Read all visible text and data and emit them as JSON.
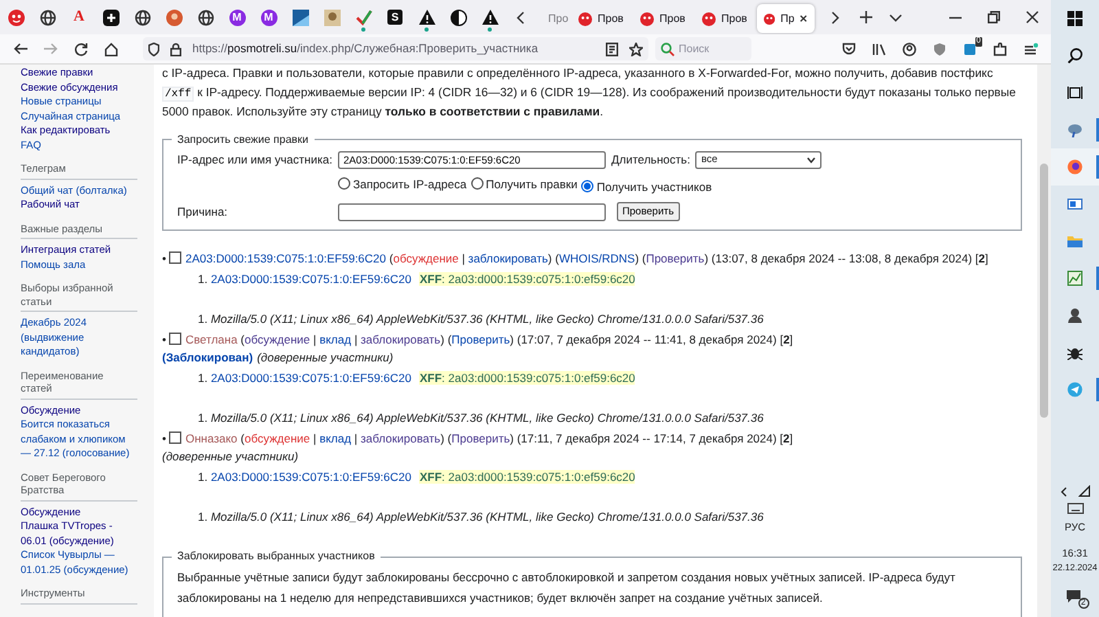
{
  "browser": {
    "pinned_tabs": [
      {
        "kind": "face"
      },
      {
        "kind": "globe"
      },
      {
        "kind": "letter",
        "text": "A",
        "color": "#e02020"
      },
      {
        "kind": "plus"
      },
      {
        "kind": "globe"
      },
      {
        "kind": "avatar"
      },
      {
        "kind": "globe"
      },
      {
        "kind": "badge-letter",
        "text": "M",
        "color": "#8a2be2"
      },
      {
        "kind": "badge-letter",
        "text": "M",
        "color": "#8a2be2"
      },
      {
        "kind": "image"
      },
      {
        "kind": "photo"
      },
      {
        "kind": "check",
        "attention": true
      },
      {
        "kind": "square-letter",
        "text": "S",
        "color": "#111111"
      },
      {
        "kind": "warning",
        "attention": true
      },
      {
        "kind": "halfcircle"
      },
      {
        "kind": "warning",
        "attention": true
      }
    ],
    "tabs": [
      {
        "label": "Про",
        "selected": false
      },
      {
        "label": "Пров",
        "selected": false
      },
      {
        "label": "Пров",
        "selected": false
      },
      {
        "label": "Пров",
        "selected": false
      },
      {
        "label": "Пр",
        "selected": true
      }
    ],
    "url_parts": [
      "https://",
      "posmotreli.su",
      "/index.php/Служебная:Проверить_участника"
    ],
    "search_placeholder": "Поиск",
    "extension_badge": "0"
  },
  "sidebar": [
    {
      "items": [
        {
          "text": "Свежие правки",
          "visited": true
        },
        {
          "text": "Свежие обсуждения",
          "visited": true
        },
        {
          "text": "Новые страницы",
          "visited": false
        },
        {
          "text": "Случайная страница",
          "visited": false
        },
        {
          "text": "Как редактировать",
          "visited": true
        },
        {
          "text": "FAQ",
          "visited": false
        }
      ]
    },
    {
      "heading": "Телеграм",
      "items": [
        {
          "text": "Общий чат (болталка)",
          "visited": false
        },
        {
          "text": "Рабочий чат",
          "visited": true
        }
      ]
    },
    {
      "heading": "Важные разделы",
      "items": [
        {
          "text": "Интеграция статей",
          "visited": true
        },
        {
          "text": "Помощь зала",
          "visited": false
        }
      ]
    },
    {
      "heading": "Выборы избранной статьи",
      "items": [
        {
          "text": "Декабрь 2024 (выдвижение кандидатов)",
          "visited": false
        }
      ]
    },
    {
      "heading": "Переименование статей",
      "items": [
        {
          "text": "Обсуждение",
          "visited": true
        },
        {
          "text": "Боится показаться слабаком и хлюпиком — 27.12 (голосование)",
          "visited": false
        }
      ]
    },
    {
      "heading": "Совет Берегового Братства",
      "items": [
        {
          "text": "Обсуждение",
          "visited": true
        },
        {
          "text": "Плашка TVTropes - 06.01 (обсуждение)",
          "visited": true
        },
        {
          "text": "Список Чувырлы — 01.01.25 (обсуждение)",
          "visited": false
        }
      ]
    },
    {
      "heading": "Инструменты"
    }
  ],
  "intro": {
    "before": "с IP-адреса. Правки и пользователи, которые правили с определённого IP-адреса, указанного в X-Forwarded-For, можно получить, добавив постфикс ",
    "code": "/xff",
    "after": " к IP-адресу. Поддерживаемые версии IP: 4 (CIDR 16—32) и 6 (CIDR 19—128). Из соображений производительности будут показаны только первые 5000 правок. Используйте эту страницу **только в соответствии с правилами**."
  },
  "query_form": {
    "legend": "Запросить свежие правки",
    "target_label": "IP-адрес или имя участника:",
    "target_value": "2A03:D000:1539:C075:1:0:EF59:6C20",
    "duration_label": "Длительность:",
    "duration_value": "все",
    "radios": [
      {
        "label": "Запросить IP-адреса",
        "selected": false
      },
      {
        "label": "Получить правки",
        "selected": false
      },
      {
        "label": "Получить участников",
        "selected": true
      }
    ],
    "reason_label": "Причина:",
    "submit": "Проверить"
  },
  "results": [
    {
      "marker": "•",
      "checked": false,
      "line": [
        {
          "kind": "link",
          "text": "2A03:D000:1539:C075:1:0:EF59:6C20",
          "new": false,
          "visited": false
        },
        {
          "kind": "text",
          "text": " ("
        },
        {
          "kind": "link",
          "text": "обсуждение",
          "new": true,
          "visited": false
        },
        {
          "kind": "text",
          "text": " | "
        },
        {
          "kind": "link",
          "text": "заблокировать",
          "new": false,
          "visited": false
        },
        {
          "kind": "text",
          "text": ") ("
        },
        {
          "kind": "link",
          "text": "WHOIS/RDNS",
          "new": false,
          "visited": false
        },
        {
          "kind": "text",
          "text": ") ("
        },
        {
          "kind": "link",
          "text": "Проверить",
          "new": false,
          "visited": true
        },
        {
          "kind": "text",
          "text": ") (13:07, 8 декабря 2024 -- 13:08, 8 декабря 2024) ["
        },
        {
          "kind": "count",
          "text": "2"
        },
        {
          "kind": "text",
          "text": "]"
        }
      ],
      "ips": [
        {
          "number": "1.",
          "ip": "2A03:D000:1539:C075:1:0:EF59:6C20",
          "xff": "**XFF**: 2a03:d000:1539:c075:1:0:ef59:6c20"
        }
      ],
      "agents": [
        {
          "number": "1.",
          "text": "Mozilla/5.0 (X11; Linux x86_64) AppleWebKit/537.36 (KHTML, like Gecko) Chrome/131.0.0.0 Safari/537.36"
        }
      ]
    },
    {
      "marker": "•",
      "checked": false,
      "line": [
        {
          "kind": "link",
          "text": "Светлана",
          "new": true,
          "visited": true
        },
        {
          "kind": "text",
          "text": " ("
        },
        {
          "kind": "link",
          "text": "обсуждение",
          "new": false,
          "visited": true
        },
        {
          "kind": "text",
          "text": " | "
        },
        {
          "kind": "link",
          "text": "вклад",
          "new": false,
          "visited": false
        },
        {
          "kind": "text",
          "text": " | "
        },
        {
          "kind": "link",
          "text": "заблокировать",
          "new": false,
          "visited": true
        },
        {
          "kind": "text",
          "text": ") ("
        },
        {
          "kind": "link",
          "text": "Проверить",
          "new": false,
          "visited": false
        },
        {
          "kind": "text",
          "text": ") (17:07, 7 декабря 2024 -- 11:41, 8 декабря 2024) ["
        },
        {
          "kind": "count",
          "text": "2"
        },
        {
          "kind": "text",
          "text": "]"
        }
      ],
      "second_line": [
        {
          "kind": "boldlink",
          "text": "(Заблокирован)",
          "new": false,
          "visited": false
        },
        {
          "kind": "italic",
          "text": "(доверенные участники)"
        }
      ],
      "ips": [
        {
          "number": "1.",
          "ip": "2A03:D000:1539:C075:1:0:EF59:6C20",
          "xff": "**XFF**: 2a03:d000:1539:c075:1:0:ef59:6c20"
        }
      ],
      "agents": [
        {
          "number": "1.",
          "text": "Mozilla/5.0 (X11; Linux x86_64) AppleWebKit/537.36 (KHTML, like Gecko) Chrome/131.0.0.0 Safari/537.36"
        }
      ]
    },
    {
      "marker": "•",
      "checked": false,
      "line": [
        {
          "kind": "link",
          "text": "Онназако",
          "new": true,
          "visited": true
        },
        {
          "kind": "text",
          "text": " ("
        },
        {
          "kind": "link",
          "text": "обсуждение",
          "new": true,
          "visited": false
        },
        {
          "kind": "text",
          "text": " | "
        },
        {
          "kind": "link",
          "text": "вклад",
          "new": false,
          "visited": false
        },
        {
          "kind": "text",
          "text": " | "
        },
        {
          "kind": "link",
          "text": "заблокировать",
          "new": false,
          "visited": true
        },
        {
          "kind": "text",
          "text": ") ("
        },
        {
          "kind": "link",
          "text": "Проверить",
          "new": false,
          "visited": true
        },
        {
          "kind": "text",
          "text": ") (17:11, 7 декабря 2024 -- 17:14, 7 декабря 2024) ["
        },
        {
          "kind": "count",
          "text": "2"
        },
        {
          "kind": "text",
          "text": "]"
        }
      ],
      "second_line": [
        {
          "kind": "italic",
          "text": "(доверенные участники)"
        }
      ],
      "ips": [
        {
          "number": "1.",
          "ip": "2A03:D000:1539:C075:1:0:EF59:6C20",
          "xff": "**XFF**: 2a03:d000:1539:c075:1:0:ef59:6c20"
        }
      ],
      "agents": [
        {
          "number": "1.",
          "text": "Mozilla/5.0 (X11; Linux x86_64) AppleWebKit/537.36 (KHTML, like Gecko) Chrome/131.0.0.0 Safari/537.36"
        }
      ]
    }
  ],
  "block_form": {
    "legend": "Заблокировать выбранных участников",
    "text": "Выбранные учётные записи будут заблокированы бессрочно с автоблокировкой и запретом создания новых учётных записей. IP-адреса будут заблокированы на 1 неделю для непредставившихся участников; будет включён запрет на создание учётных записей."
  },
  "taskbar": {
    "apps": [
      {
        "kind": "windows",
        "running": false,
        "selected": false
      },
      {
        "kind": "search",
        "running": false,
        "selected": false
      },
      {
        "kind": "taskview",
        "running": false,
        "selected": false
      },
      {
        "kind": "cloud",
        "running": true,
        "selected": false
      },
      {
        "kind": "firefox",
        "running": true,
        "selected": true
      },
      {
        "kind": "window",
        "running": false,
        "selected": false
      },
      {
        "kind": "folder",
        "running": false,
        "selected": false
      },
      {
        "kind": "chart",
        "running": true,
        "selected": false
      },
      {
        "kind": "portrait",
        "running": false,
        "selected": false
      },
      {
        "kind": "bug",
        "running": false,
        "selected": false
      },
      {
        "kind": "messenger",
        "running": true,
        "selected": false
      }
    ],
    "language": "РУС",
    "time": "16:31",
    "date": "22.12.2024",
    "notifications": "2"
  }
}
